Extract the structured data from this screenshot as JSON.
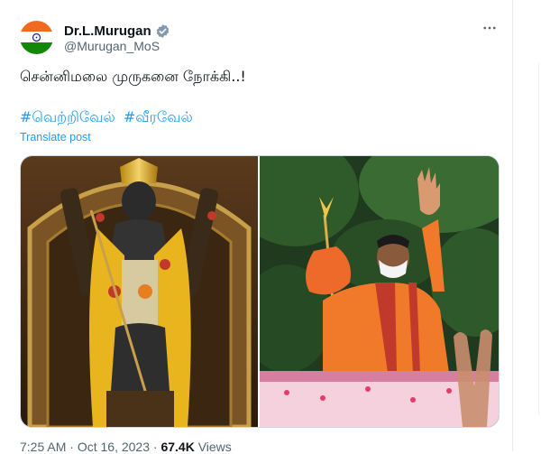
{
  "author": {
    "display_name": "Dr.L.Murugan",
    "handle": "@Murugan_MoS",
    "verified": true,
    "avatar_icon": "india-flag-avatar"
  },
  "tweet": {
    "text": "சென்னிமலை முருகனை நோக்கி..!",
    "hashtags": [
      "#வெற்றிவேல்",
      "#வீரவேல்"
    ],
    "translate_label": "Translate post"
  },
  "media": {
    "count": 2,
    "photos": [
      {
        "name": "deity-photo"
      },
      {
        "name": "politician-photo"
      }
    ]
  },
  "meta": {
    "time": "7:25 AM",
    "separator": "·",
    "date": "Oct 16, 2023",
    "views_count": "67.4K",
    "views_label": "Views"
  },
  "icons": {
    "more": "more-options-icon",
    "verified": "verified-badge-icon"
  },
  "colors": {
    "link": "#1d9bf0",
    "text": "#0f1419",
    "muted": "#536471"
  }
}
